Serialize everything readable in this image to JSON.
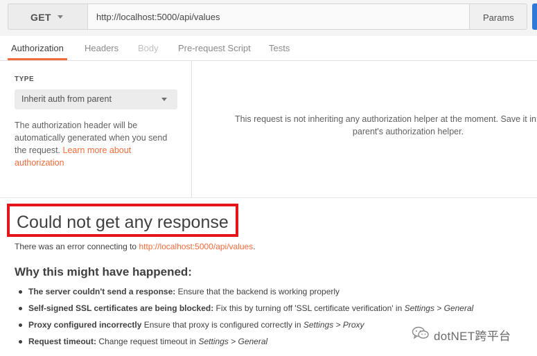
{
  "request": {
    "method": "GET",
    "url": "http://localhost:5000/api/values",
    "params_label": "Params"
  },
  "tabs": [
    {
      "label": "Authorization",
      "state": "active"
    },
    {
      "label": "Headers",
      "state": "normal"
    },
    {
      "label": "Body",
      "state": "disabled"
    },
    {
      "label": "Pre-request Script",
      "state": "normal"
    },
    {
      "label": "Tests",
      "state": "normal"
    }
  ],
  "auth": {
    "type_label": "TYPE",
    "type_value": "Inherit auth from parent",
    "description": "The authorization header will be automatically generated when you send the request. ",
    "learn_more": "Learn more about authorization",
    "info_line1": "This request is not inheriting any authorization helper at the moment. Save it in a collection to use the",
    "info_line2": "parent's authorization helper."
  },
  "error": {
    "title": "Could not get any response",
    "message_prefix": "There was an error connecting to ",
    "message_link": "http://localhost:5000/api/values",
    "message_suffix": ".",
    "why_heading": "Why this might have happened:",
    "reasons": [
      {
        "bold": "The server couldn't send a response:",
        "text": " Ensure that the backend is working properly",
        "italic1": "",
        "mid": "",
        "italic2": ""
      },
      {
        "bold": "Self-signed SSL certificates are being blocked:",
        "text": " Fix this by turning off 'SSL certificate verification' in ",
        "italic1": "Settings",
        "mid": " > ",
        "italic2": "General"
      },
      {
        "bold": "Proxy configured incorrectly",
        "text": " Ensure that proxy is configured correctly in ",
        "italic1": "Settings",
        "mid": " > ",
        "italic2": "Proxy"
      },
      {
        "bold": "Request timeout:",
        "text": " Change request timeout in ",
        "italic1": "Settings",
        "mid": " > ",
        "italic2": "General"
      }
    ]
  },
  "watermark": {
    "icon": "wechat-icon",
    "text": "dotNET跨平台"
  },
  "colors": {
    "accent": "#f26b3a",
    "send_button": "#2f7ad9",
    "highlight_border": "#e5141b"
  }
}
